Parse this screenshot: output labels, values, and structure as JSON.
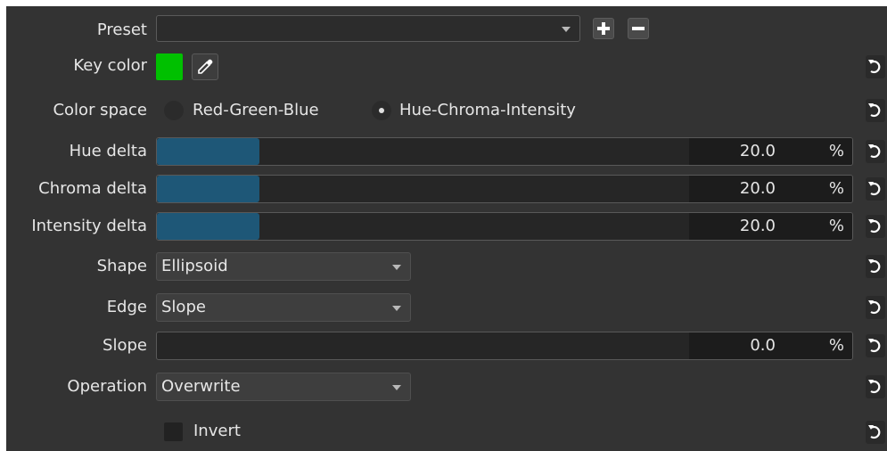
{
  "preset": {
    "label": "Preset",
    "value": "",
    "add_icon": "plus-icon",
    "remove_icon": "minus-icon"
  },
  "key_color": {
    "label": "Key color",
    "color": "#00c000",
    "picker_icon": "eyedropper-icon"
  },
  "color_space": {
    "label": "Color space",
    "options": [
      "Red-Green-Blue",
      "Hue-Chroma-Intensity"
    ],
    "selected": "Hue-Chroma-Intensity"
  },
  "hue_delta": {
    "label": "Hue delta",
    "value": "20.0",
    "unit": "%",
    "fraction": 0.2
  },
  "chroma_delta": {
    "label": "Chroma delta",
    "value": "20.0",
    "unit": "%",
    "fraction": 0.2
  },
  "intensity_delta": {
    "label": "Intensity delta",
    "value": "20.0",
    "unit": "%",
    "fraction": 0.2
  },
  "shape": {
    "label": "Shape",
    "value": "Ellipsoid"
  },
  "edge": {
    "label": "Edge",
    "value": "Slope"
  },
  "slope": {
    "label": "Slope",
    "value": "0.0",
    "unit": "%",
    "fraction": 0.0
  },
  "operation": {
    "label": "Operation",
    "value": "Overwrite"
  },
  "invert": {
    "label": "Invert",
    "checked": false
  },
  "reset_icon": "reset-icon",
  "colors": {
    "background": "#333333",
    "slider_fill": "#1e5777",
    "key": "#00c000"
  }
}
